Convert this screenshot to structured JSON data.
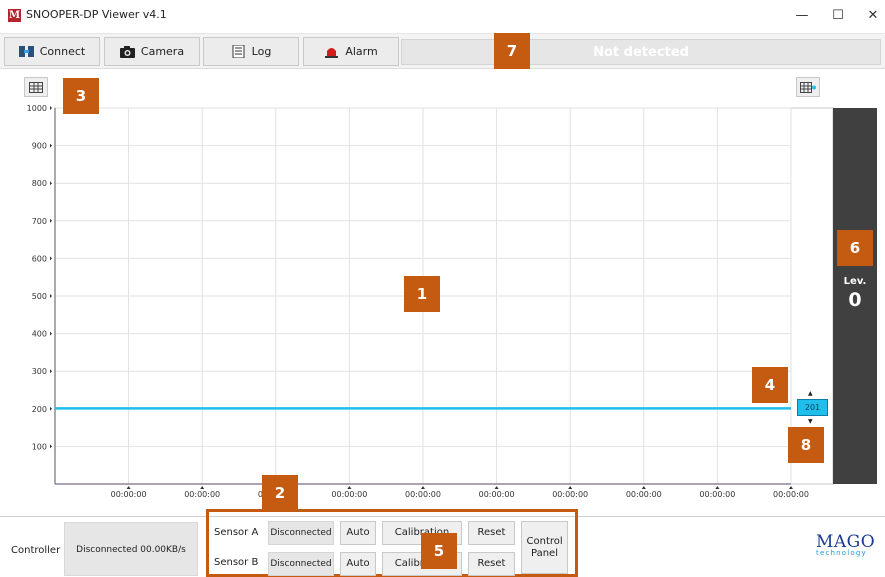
{
  "window": {
    "title": "SNOOPER-DP Viewer v4.1",
    "logo_letter": "M",
    "minimize": "—",
    "maximize": "☐",
    "close": "✕"
  },
  "toolbar": {
    "connect_label": "Connect",
    "camera_label": "Camera",
    "log_label": "Log",
    "alarm_label": "Alarm",
    "status_text": "Not detected"
  },
  "chart_data": {
    "type": "line",
    "title": "",
    "xlabel": "",
    "ylabel": "",
    "ylim": [
      0,
      1000
    ],
    "y_ticks": [
      "1000",
      "900",
      "800",
      "700",
      "600",
      "500",
      "400",
      "300",
      "200",
      "100"
    ],
    "x_ticks": [
      "00:00:00",
      "00:00:00",
      "00:00:00",
      "00:00:00",
      "00:00:00",
      "00:00:00",
      "00:00:00",
      "00:00:00",
      "00:00:00",
      "00:00:00"
    ],
    "series": [
      {
        "values": [
          201,
          201,
          201,
          201,
          201,
          201,
          201,
          201,
          201,
          201,
          201
        ],
        "color": "#1ebfea"
      }
    ],
    "grid": true,
    "current_value": "201"
  },
  "level": {
    "label": "Lev.",
    "value": "0"
  },
  "badges": [
    "1",
    "2",
    "3",
    "4",
    "5",
    "6",
    "7",
    "8"
  ],
  "controller": {
    "label": "Controller",
    "status": "Disconnected 00.00KB/s"
  },
  "sensors": [
    {
      "label": "Sensor A",
      "status": "Disconnected",
      "auto": "Auto",
      "calibration": "Calibration",
      "reset": "Reset"
    },
    {
      "label": "Sensor B",
      "status": "Disconnected",
      "auto": "Auto",
      "calibration": "Calibration",
      "reset": "Reset"
    }
  ],
  "control_panel_label": "Control Panel",
  "brand": {
    "name": "MAGO",
    "tagline": "technology",
    "color": "#1a3a8f"
  },
  "colors": {
    "accent_badge": "#c55a11",
    "series_line": "#1ebfea",
    "level_panel": "#404040"
  }
}
